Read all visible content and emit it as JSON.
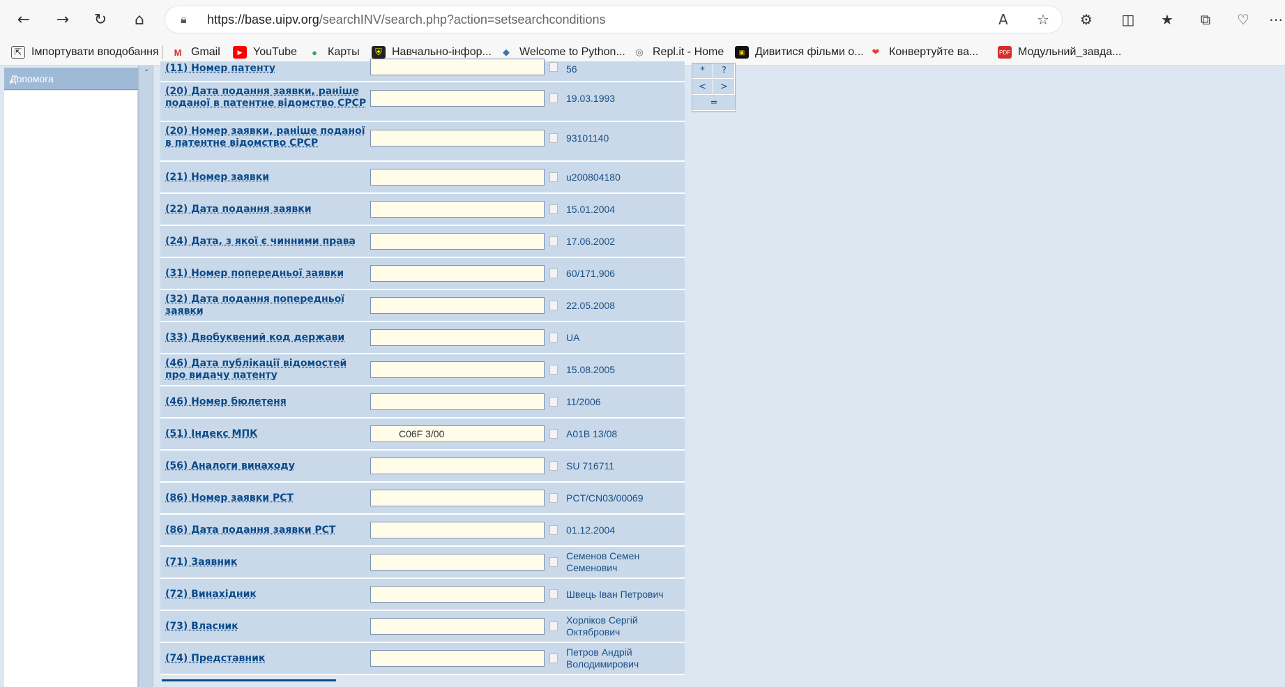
{
  "browser": {
    "url_host": "https://base.uipv.org",
    "url_path": "/searchINV/search.php?action=setsearchconditions",
    "bookmarks": [
      {
        "label": "Імпортувати вподобання"
      },
      {
        "label": "Gmail"
      },
      {
        "label": "YouTube"
      },
      {
        "label": "Карты"
      },
      {
        "label": "Навчально-інфор..."
      },
      {
        "label": "Welcome to Python..."
      },
      {
        "label": "Repl.it - Home"
      },
      {
        "label": "Дивитися фільми о..."
      },
      {
        "label": "Конвертуйте ва..."
      },
      {
        "label": "Модульний_завда..."
      }
    ]
  },
  "sidebar": {
    "help_label": "Допомога"
  },
  "operators": [
    "*",
    "?",
    "<",
    ">",
    "="
  ],
  "rows": [
    {
      "label": "(11) Номер патенту",
      "input": "",
      "value": "56"
    },
    {
      "label": "(20) Дата подання заявки, раніше поданої в патентне відомство СРСР",
      "input": "",
      "value": "19.03.1993"
    },
    {
      "label": "(20) Номер заявки, раніше поданої в патентне відомство СРСР",
      "input": "",
      "value": "93101140"
    },
    {
      "label": "(21) Номер заявки",
      "input": "",
      "value": "u200804180"
    },
    {
      "label": "(22) Дата подання заявки",
      "input": "",
      "value": "15.01.2004"
    },
    {
      "label": "(24) Дата, з якої є чинними права",
      "input": "",
      "value": "17.06.2002"
    },
    {
      "label": "(31) Номер попередньої заявки",
      "input": "",
      "value": "60/171,906"
    },
    {
      "label": "(32) Дата подання попередньої заявки",
      "input": "",
      "value": "22.05.2008"
    },
    {
      "label": "(33) Двобуквений код держави",
      "input": "",
      "value": "UA"
    },
    {
      "label": "(46) Дата публікації відомостей про видачу патенту",
      "input": "",
      "value": "15.08.2005"
    },
    {
      "label": "(46) Номер бюлетеня",
      "input": "",
      "value": "11/2006"
    },
    {
      "label": "(51) Індекс МПК",
      "input": "C06F 3/00",
      "value": "A01B 13/08"
    },
    {
      "label": "(56) Аналоги винаходу",
      "input": "",
      "value": "SU 716711"
    },
    {
      "label": "(86) Номер заявки PCT",
      "input": "",
      "value": "PCT/CN03/00069"
    },
    {
      "label": "(86) Дата подання заявки PCT",
      "input": "",
      "value": "01.12.2004"
    },
    {
      "label": "(71) Заявник",
      "input": "",
      "value": "Семенов Семен Семенович"
    },
    {
      "label": "(72) Винахідник",
      "input": "",
      "value": "Швець Іван Петрович"
    },
    {
      "label": "(73) Власник",
      "input": "",
      "value": "Хорліков Сергій Октябрович"
    },
    {
      "label": "(74) Представник",
      "input": "",
      "value": "Петров Андрій Володимирович"
    }
  ]
}
